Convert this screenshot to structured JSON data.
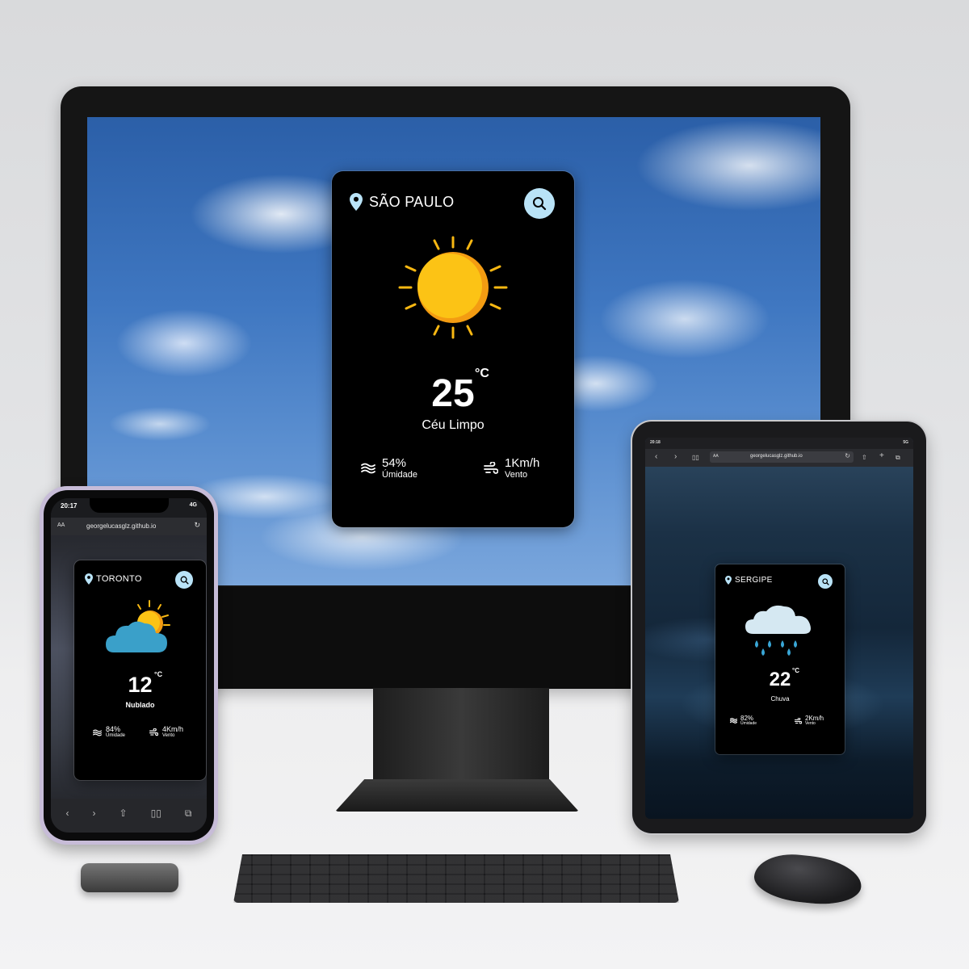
{
  "desktop": {
    "card": {
      "city": "SÃO PAULO",
      "temperature": "25",
      "unit": "°C",
      "description": "Céu Limpo",
      "humidity_value": "54%",
      "humidity_label": "Úmidade",
      "wind_value": "1Km/h",
      "wind_label": "Vento",
      "weather_icon": "sun-icon"
    }
  },
  "phone": {
    "status": {
      "time": "20:17",
      "network": "4G"
    },
    "browser": {
      "aa": "AA",
      "url": "georgelucasglz.github.io"
    },
    "toolbar": [
      "back-icon",
      "forward-icon",
      "share-icon",
      "bookmarks-icon",
      "tabs-icon"
    ],
    "card": {
      "city": "TORONTO",
      "temperature": "12",
      "unit": "°C",
      "description": "Nublado",
      "humidity_value": "84%",
      "humidity_label": "Úmidade",
      "wind_value": "4Km/h",
      "wind_label": "Vento",
      "weather_icon": "partly-cloudy-icon"
    }
  },
  "tablet": {
    "status": {
      "time": "20:18",
      "network": "5G"
    },
    "browser": {
      "aa": "AA",
      "url": "georgelucasglz.github.io"
    },
    "card": {
      "city": "SERGIPE",
      "temperature": "22",
      "unit": "°C",
      "description": "Chuva",
      "humidity_value": "82%",
      "humidity_label": "Úmidade",
      "wind_value": "2Km/h",
      "wind_label": "Vento",
      "weather_icon": "rain-cloud-icon"
    }
  },
  "colors": {
    "card_bg": "#000000",
    "search_button": "#b9e3f7",
    "sun": "#fcbf12",
    "sun_ray": "#f9b812",
    "cloud": "#3aa0c9",
    "rain_cloud": "#d5e8f2",
    "rain_drop": "#39a6d6"
  }
}
